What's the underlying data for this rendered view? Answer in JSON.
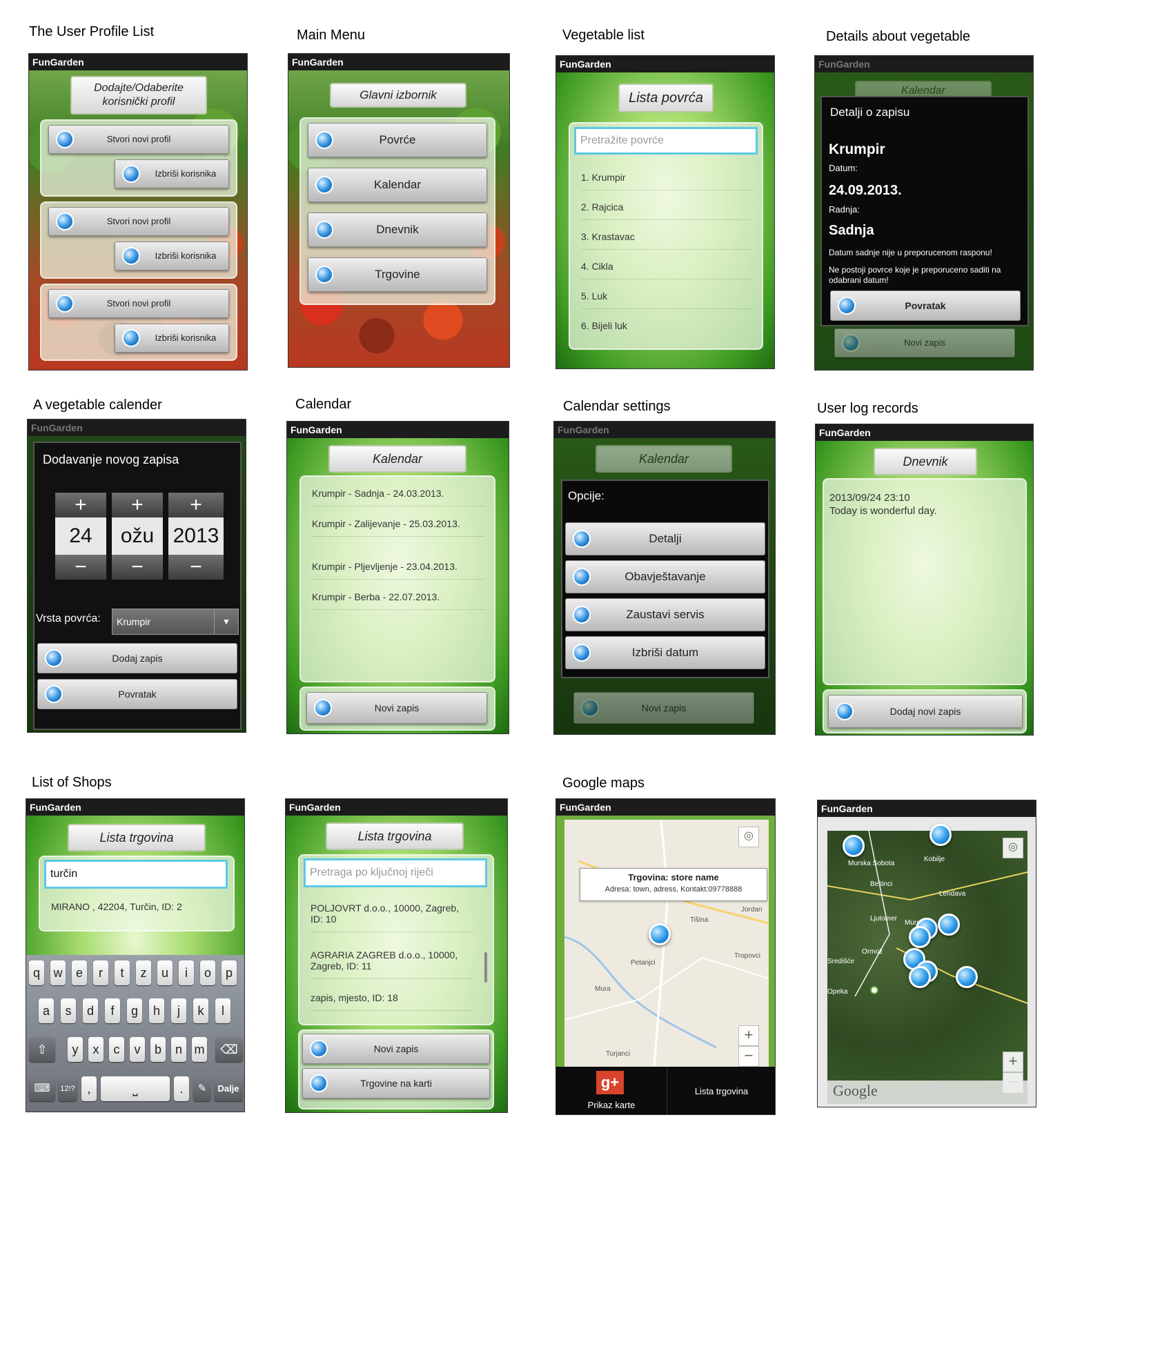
{
  "app_name": "FunGarden",
  "captions": {
    "profile": "The User Profile List",
    "menu": "Main Menu",
    "veglist": "Vegetable list",
    "details": "Details about vegetable",
    "vegcal": "A vegetable calender",
    "calendar": "Calendar",
    "calsettings": "Calendar settings",
    "userlog": "User log records",
    "shops": "List of Shops",
    "maps": "Google maps"
  },
  "profile": {
    "header": "Dodajte/Odaberite korisnički profil",
    "create": "Stvori novi profil",
    "delete": "Izbriši korisnika"
  },
  "menu": {
    "header": "Glavni izbornik",
    "items": [
      "Povrće",
      "Kalendar",
      "Dnevnik",
      "Trgovine"
    ]
  },
  "veglist": {
    "header": "Lista povrća",
    "placeholder": "Pretražite povrće",
    "items": [
      "1. Krumpir",
      "2. Rajcica",
      "3. Krastavac",
      "4. Cikla",
      "5. Luk",
      "6. Bijeli luk"
    ]
  },
  "details": {
    "title": "Detalji o zapisu",
    "veg": "Krumpir",
    "date_label": "Datum:",
    "date": "24.09.2013.",
    "action_label": "Radnja:",
    "action": "Sadnja",
    "warn1": "Datum sadnje nije u preporucenom rasponu!",
    "warn2": "Ne postoji povrce koje je preporuceno saditi na odabrani datum!",
    "back": "Povratak",
    "bg_top": "Kalendar",
    "bg_btn": "Novi zapis"
  },
  "vegcal": {
    "title": "Dodavanje novog zapisa",
    "day": "24",
    "month": "ožu",
    "year": "2013",
    "plus": "+",
    "minus": "−",
    "veg_label": "Vrsta povrća:",
    "veg_value": "Krumpir",
    "add": "Dodaj zapis",
    "back": "Povratak"
  },
  "calendar": {
    "header": "Kalendar",
    "items": [
      "Krumpir - Sadnja - 24.03.2013.",
      "Krumpir - Zalijevanje - 25.03.2013.",
      "Krumpir - Pljevljenje - 23.04.2013.",
      "Krumpir - Berba - 22.07.2013."
    ],
    "new": "Novi zapis"
  },
  "calsettings": {
    "header": "Kalendar",
    "title": "Opcije:",
    "items": [
      "Detalji",
      "Obavještavanje",
      "Zaustavi servis",
      "Izbriši datum"
    ],
    "bg_btn": "Novi zapis"
  },
  "userlog": {
    "header": "Dnevnik",
    "entry_time": "2013/09/24 23:10",
    "entry_text": "Today is wonderful day.",
    "add": "Dodaj novi zapis"
  },
  "shops1": {
    "header": "Lista trgovina",
    "query": "turčin",
    "result": "MIRANO , 42204, Turčin, ID: 2",
    "keys_row1": [
      "q",
      "w",
      "e",
      "r",
      "t",
      "z",
      "u",
      "i",
      "o",
      "p"
    ],
    "keys_row2": [
      "a",
      "s",
      "d",
      "f",
      "g",
      "h",
      "j",
      "k",
      "l"
    ],
    "keys_row3": [
      "y",
      "x",
      "c",
      "v",
      "b",
      "n",
      "m"
    ],
    "shift": "⇧",
    "backspace": "⌫",
    "kb_icon": "⌨",
    "sym": "12!?",
    "comma": ",",
    "space": "⎵",
    "period": ".",
    "next": "Dalje"
  },
  "shops2": {
    "header": "Lista trgovina",
    "placeholder": "Pretraga po ključnoj riječi",
    "items": [
      "POLJOVRT d.o.o., 10000, Zagreb, ID: 10",
      "AGRARIA ZAGREB d.o.o., 10000, Zagreb, ID: 11",
      "zapis, mjesto, ID: 18"
    ],
    "new": "Novi zapis",
    "onmap": "Trgovine na karti"
  },
  "maps1": {
    "popup_title": "Trgovina: store name",
    "popup_text": "Adresa: town, adress, Kontakt:09778888",
    "places": [
      "Petanjci",
      "Tišina",
      "Jordan",
      "Tropovci",
      "Mura",
      "Turjanci"
    ],
    "tab_map": "Prikaz karte",
    "tab_list": "Lista trgovina",
    "zoom_in": "+",
    "zoom_out": "−"
  },
  "maps2": {
    "places": [
      "Murska Sobota",
      "Beltinci",
      "Lendava",
      "Ljutomer",
      "Ormož",
      "Kobilje",
      "Murs",
      "Središće",
      "Opeka"
    ],
    "logo": "Google",
    "zoom_in": "+",
    "zoom_out": "−"
  }
}
